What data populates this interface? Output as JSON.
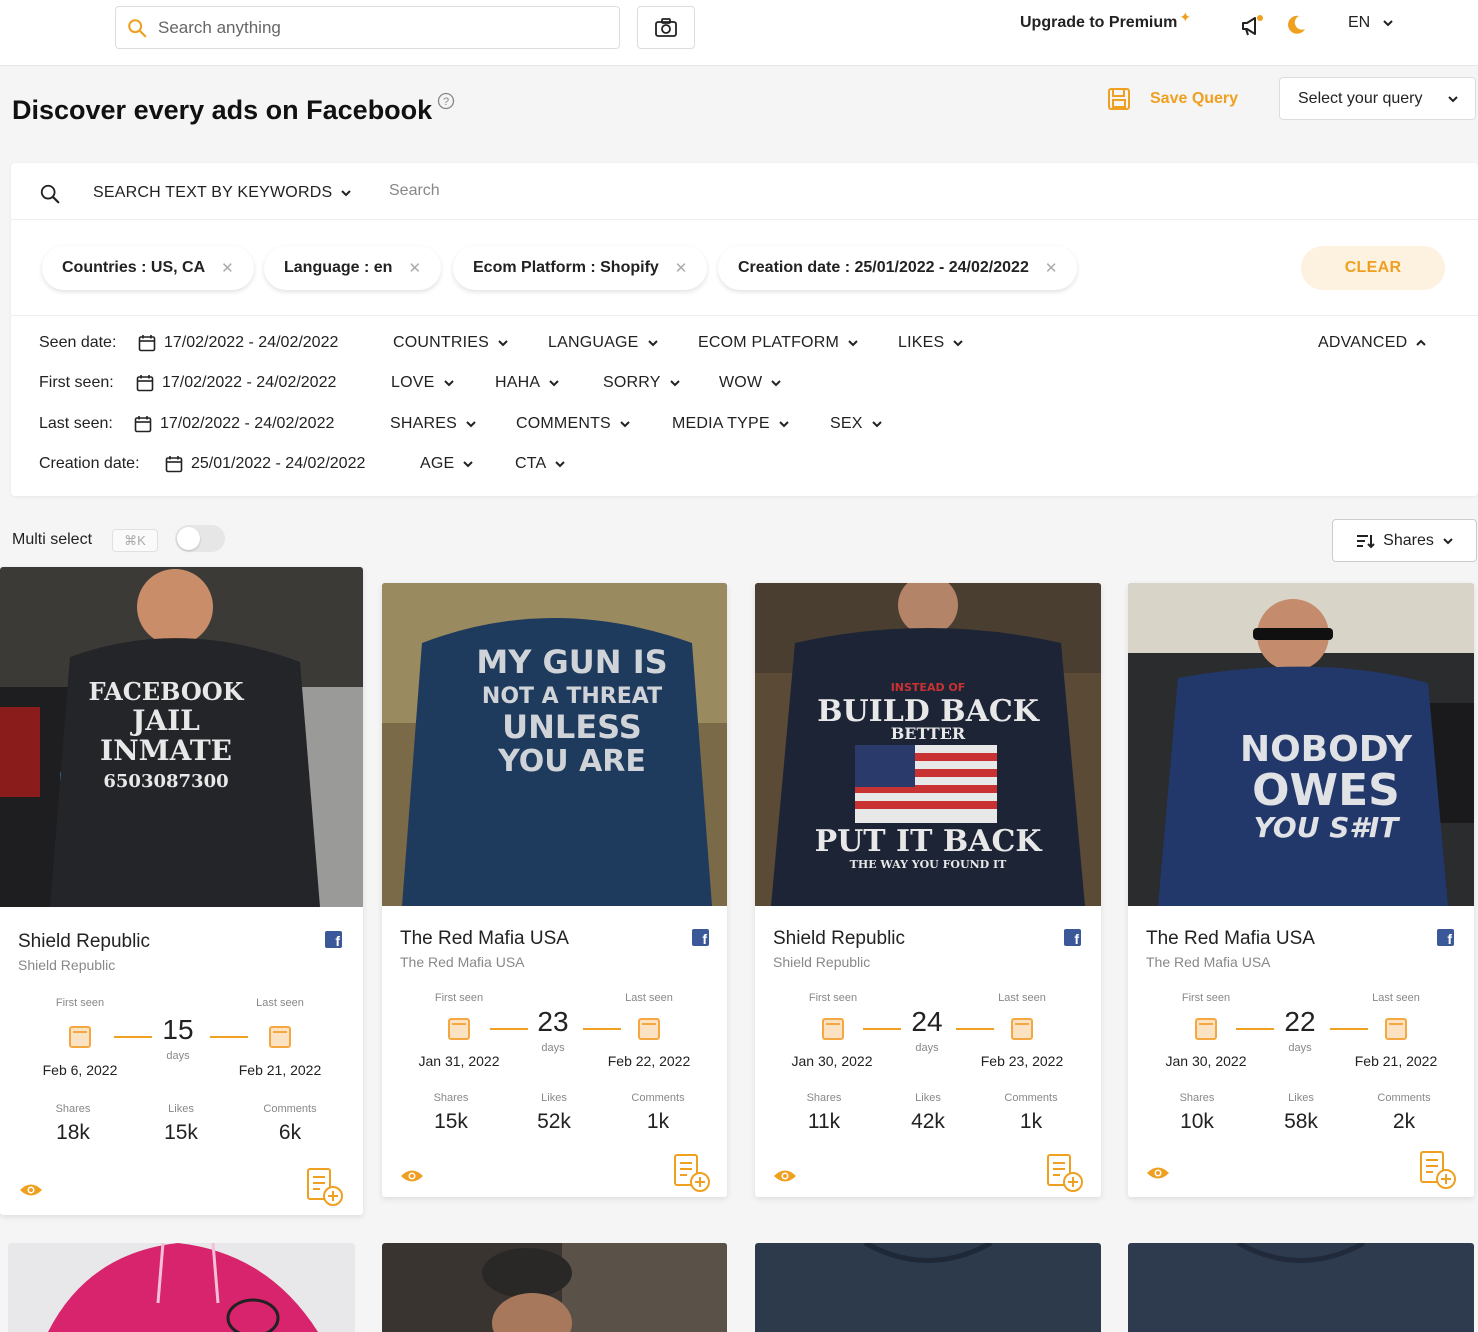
{
  "topbar": {
    "search_placeholder": "Search anything",
    "upgrade_label": "Upgrade to Premium",
    "lang": "EN"
  },
  "header": {
    "title": "Discover every ads on Facebook",
    "save_query": "Save Query",
    "select_query": "Select your query"
  },
  "keyword": {
    "dropdown": "SEARCH TEXT BY KEYWORDS",
    "placeholder": "Search"
  },
  "chips": [
    "Countries : US, CA",
    "Language : en",
    "Ecom Platform : Shopify",
    "Creation date : 25/01/2022 - 24/02/2022"
  ],
  "clear_label": "CLEAR",
  "filters": {
    "seen_date": {
      "label": "Seen date:",
      "value": "17/02/2022 - 24/02/2022"
    },
    "first_seen": {
      "label": "First seen:",
      "value": "17/02/2022 - 24/02/2022"
    },
    "last_seen": {
      "label": "Last seen:",
      "value": "17/02/2022 - 24/02/2022"
    },
    "creation_date": {
      "label": "Creation date:",
      "value": "25/01/2022 - 24/02/2022"
    },
    "row1": [
      "COUNTRIES",
      "LANGUAGE",
      "ECOM PLATFORM",
      "LIKES"
    ],
    "row2": [
      "LOVE",
      "HAHA",
      "SORRY",
      "WOW"
    ],
    "row3": [
      "SHARES",
      "COMMENTS",
      "MEDIA TYPE",
      "SEX"
    ],
    "row4": [
      "AGE",
      "CTA"
    ],
    "advanced": "ADVANCED"
  },
  "multi_select": {
    "label": "Multi select",
    "shortcut": "⌘K"
  },
  "sort": {
    "label": "Shares"
  },
  "labels": {
    "first_seen": "First seen",
    "last_seen": "Last seen",
    "days": "days",
    "shares": "Shares",
    "likes": "Likes",
    "comments": "Comments"
  },
  "cards": [
    {
      "brand": "Shield Republic",
      "sub": "Shield Republic",
      "days": "15",
      "first": "Feb 6, 2022",
      "last": "Feb 21, 2022",
      "shares": "18k",
      "likes": "15k",
      "comments": "6k",
      "shirt_text": [
        "FACEBOOK",
        "JAIL",
        "INMATE",
        "6503087300"
      ]
    },
    {
      "brand": "The Red Mafia USA",
      "sub": "The Red Mafia USA",
      "days": "23",
      "first": "Jan 31, 2022",
      "last": "Feb 22, 2022",
      "shares": "15k",
      "likes": "52k",
      "comments": "1k",
      "shirt_text": [
        "MY GUN IS",
        "NOT A THREAT",
        "UNLESS",
        "YOU ARE"
      ]
    },
    {
      "brand": "Shield Republic",
      "sub": "Shield Republic",
      "days": "24",
      "first": "Jan 30, 2022",
      "last": "Feb 23, 2022",
      "shares": "11k",
      "likes": "42k",
      "comments": "1k",
      "shirt_text": [
        "INSTEAD OF",
        "BUILD BACK",
        "BETTER",
        "PUT IT BACK",
        "THE WAY YOU FOUND IT"
      ]
    },
    {
      "brand": "The Red Mafia USA",
      "sub": "The Red Mafia USA",
      "days": "22",
      "first": "Jan 30, 2022",
      "last": "Feb 21, 2022",
      "shares": "10k",
      "likes": "58k",
      "comments": "2k",
      "shirt_text": [
        "NOBODY",
        "OWES",
        "YOU S#IT"
      ]
    }
  ],
  "colors": {
    "accent": "#f0a020",
    "facebook": "#3b5998"
  }
}
